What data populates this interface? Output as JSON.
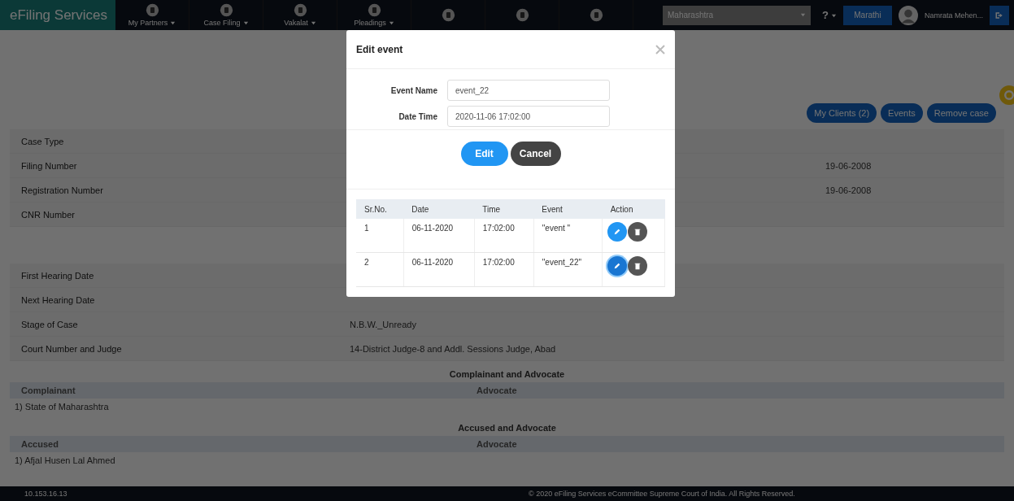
{
  "navbar": {
    "brand": "eFiling Services",
    "items": [
      {
        "label": "My Partners"
      },
      {
        "label": "Case Filing"
      },
      {
        "label": "Vakalat"
      },
      {
        "label": "Pleadings"
      }
    ],
    "state_select": "Maharashtra",
    "help": "?",
    "language_button": "Marathi",
    "user_name": "Namrata Mehen..."
  },
  "actions": [
    "My Clients (2)",
    "Events",
    "Remove case"
  ],
  "case_details": [
    {
      "label": "Case Type"
    },
    {
      "label": "Filing Number",
      "column_3": "19-06-2008"
    },
    {
      "label": "Registration Number",
      "column_3": "19-06-2008"
    },
    {
      "label": "CNR Number"
    }
  ],
  "hearing_details": [
    {
      "label": "First Hearing Date"
    },
    {
      "label": "Next Hearing Date"
    },
    {
      "label": "Stage of Case",
      "value": "N.B.W._Unready"
    },
    {
      "label": "Court Number and Judge",
      "value": "14-District Judge-8 and Addl. Sessions Judge, Abad"
    }
  ],
  "parties": [
    {
      "title": "Complainant and Advocate",
      "columns": [
        "Complainant",
        "Advocate"
      ],
      "rows": [
        [
          "1) State of Maharashtra",
          ""
        ]
      ]
    },
    {
      "title": "Accused and Advocate",
      "columns": [
        "Accused",
        "Advocate"
      ],
      "rows": [
        [
          "1) Afjal Husen Lal Ahmed",
          ""
        ]
      ]
    }
  ],
  "footer": {
    "ip": "10.153.16.13",
    "copyright": "© 2020 eFiling Services eCommittee Supreme Court of India. All Rights Reserved."
  },
  "dialog": {
    "title": "Edit event",
    "fields": [
      {
        "label": "Event Name",
        "value": "event_22"
      },
      {
        "label": "Date Time",
        "value": "2020-11-06 17:02:00"
      }
    ],
    "buttons": [
      "Edit",
      "Cancel"
    ],
    "table": {
      "columns": [
        "Sr.No.",
        "Date",
        "Time",
        "Event",
        "Action"
      ],
      "rows": [
        {
          "cells": [
            "1",
            "06-11-2020",
            "17:02:00",
            "\"event \""
          ],
          "selected": false
        },
        {
          "cells": [
            "2",
            "06-11-2020",
            "17:02:00",
            "\"event_22\""
          ],
          "selected": true
        }
      ]
    }
  }
}
